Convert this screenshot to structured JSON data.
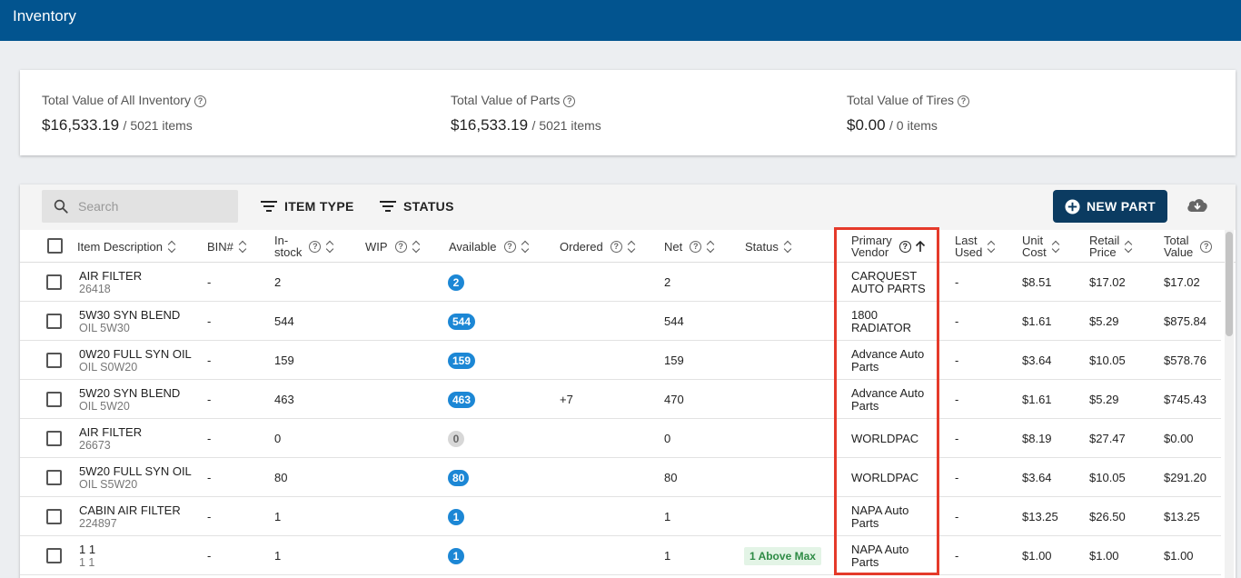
{
  "header": {
    "title": "Inventory"
  },
  "summary": [
    {
      "label": "Total Value of All Inventory",
      "amount": "$16,533.19",
      "count": "/ 5021 items"
    },
    {
      "label": "Total Value of Parts",
      "amount": "$16,533.19",
      "count": "/ 5021 items"
    },
    {
      "label": "Total Value of Tires",
      "amount": "$0.00",
      "count": "/ 0 items"
    }
  ],
  "toolbar": {
    "search_placeholder": "Search",
    "filter_item_type": "ITEM TYPE",
    "filter_status": "STATUS",
    "new_part": "NEW PART"
  },
  "columns": {
    "item_description": "Item Description",
    "bin": "BIN#",
    "in_stock_1": "In-",
    "in_stock_2": "stock",
    "wip": "WIP",
    "available": "Available",
    "ordered": "Ordered",
    "net": "Net",
    "status": "Status",
    "vendor_1": "Primary",
    "vendor_2": "Vendor",
    "last_used_1": "Last",
    "last_used_2": "Used",
    "unit_cost_1": "Unit",
    "unit_cost_2": "Cost",
    "retail_1": "Retail",
    "retail_2": "Price",
    "total_1": "Total",
    "total_2": "Value"
  },
  "rows": [
    {
      "name": "AIR FILTER",
      "part": "26418",
      "bin": "-",
      "instock": "2",
      "wip": "",
      "available": "2",
      "ordered": "",
      "net": "2",
      "status": "",
      "vendor1": "CARQUEST",
      "vendor2": "AUTO PARTS",
      "last_used": "-",
      "unit_cost": "$8.51",
      "retail": "$17.02",
      "total": "$17.02"
    },
    {
      "name": "5W30 SYN BLEND",
      "part": "OIL 5W30",
      "bin": "-",
      "instock": "544",
      "wip": "",
      "available": "544",
      "ordered": "",
      "net": "544",
      "status": "",
      "vendor1": "1800",
      "vendor2": "RADIATOR",
      "last_used": "-",
      "unit_cost": "$1.61",
      "retail": "$5.29",
      "total": "$875.84"
    },
    {
      "name": "0W20 FULL SYN OIL",
      "part": "OIL S0W20",
      "bin": "-",
      "instock": "159",
      "wip": "",
      "available": "159",
      "ordered": "",
      "net": "159",
      "status": "",
      "vendor1": "Advance Auto",
      "vendor2": "Parts",
      "last_used": "-",
      "unit_cost": "$3.64",
      "retail": "$10.05",
      "total": "$578.76"
    },
    {
      "name": "5W20 SYN BLEND",
      "part": "OIL 5W20",
      "bin": "-",
      "instock": "463",
      "wip": "",
      "available": "463",
      "ordered": "+7",
      "net": "470",
      "status": "",
      "vendor1": "Advance Auto",
      "vendor2": "Parts",
      "last_used": "-",
      "unit_cost": "$1.61",
      "retail": "$5.29",
      "total": "$745.43"
    },
    {
      "name": "AIR FILTER",
      "part": "26673",
      "bin": "-",
      "instock": "0",
      "wip": "",
      "available": "0",
      "ordered": "",
      "net": "0",
      "status": "",
      "vendor1": "WORLDPAC",
      "vendor2": "",
      "last_used": "-",
      "unit_cost": "$8.19",
      "retail": "$27.47",
      "total": "$0.00"
    },
    {
      "name": "5W20 FULL SYN OIL",
      "part": "OIL S5W20",
      "bin": "-",
      "instock": "80",
      "wip": "",
      "available": "80",
      "ordered": "",
      "net": "80",
      "status": "",
      "vendor1": "WORLDPAC",
      "vendor2": "",
      "last_used": "-",
      "unit_cost": "$3.64",
      "retail": "$10.05",
      "total": "$291.20"
    },
    {
      "name": "CABIN AIR FILTER",
      "part": "224897",
      "bin": "-",
      "instock": "1",
      "wip": "",
      "available": "1",
      "ordered": "",
      "net": "1",
      "status": "",
      "vendor1": "NAPA Auto",
      "vendor2": "Parts",
      "last_used": "-",
      "unit_cost": "$13.25",
      "retail": "$26.50",
      "total": "$13.25"
    },
    {
      "name": "1 1",
      "part": "1 1",
      "bin": "-",
      "instock": "1",
      "wip": "",
      "available": "1",
      "ordered": "",
      "net": "1",
      "status": "1 Above Max",
      "vendor1": "NAPA Auto",
      "vendor2": "Parts",
      "last_used": "-",
      "unit_cost": "$1.00",
      "retail": "$1.00",
      "total": "$1.00"
    }
  ],
  "colors": {
    "topbar": "#02548f",
    "new_part_button": "#0b3b61",
    "badge": "#1c87d5",
    "highlight": "#e53a2a",
    "status_tag_text": "#2e8b45"
  }
}
